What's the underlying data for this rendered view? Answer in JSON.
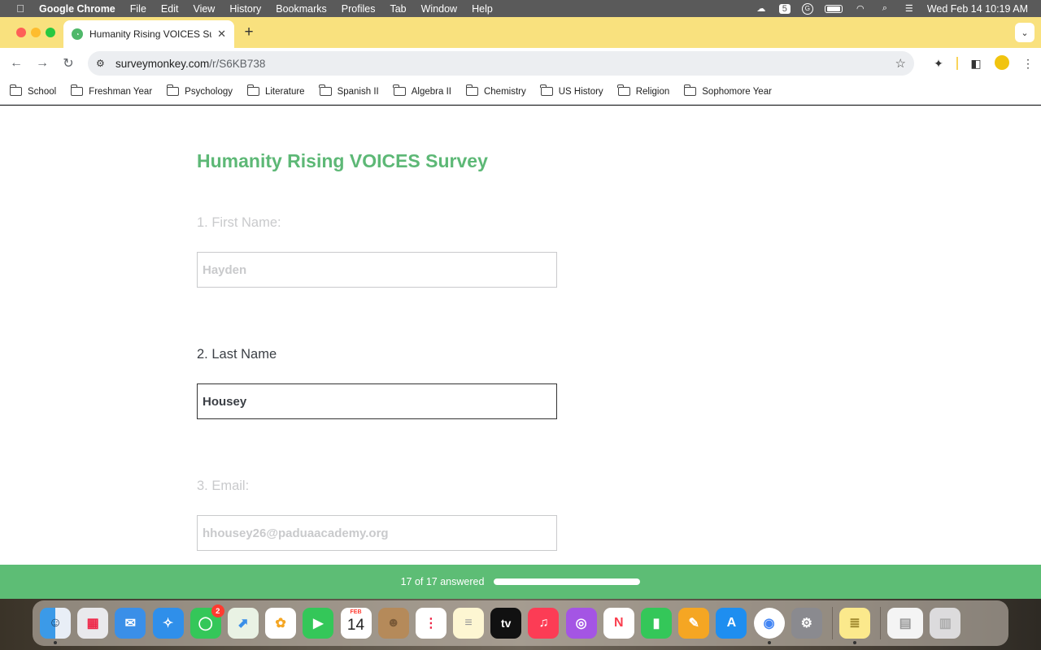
{
  "menubar": {
    "app_name": "Google Chrome",
    "items": [
      "File",
      "Edit",
      "View",
      "History",
      "Bookmarks",
      "Profiles",
      "Tab",
      "Window",
      "Help"
    ],
    "clock": "Wed Feb 14  10:19 AM"
  },
  "tab": {
    "title": "Humanity Rising VOICES Surv",
    "close": "✕"
  },
  "newtab": "+",
  "omnibox": {
    "url_host": "surveymonkey.com",
    "url_path": "/r/S6KB738"
  },
  "bookmarks": [
    "School",
    "Freshman Year",
    "Psychology",
    "Literature",
    "Spanish II",
    "Algebra II",
    "Chemistry",
    "US History",
    "Religion",
    "Sophomore Year"
  ],
  "survey": {
    "title": "Humanity Rising VOICES Survey",
    "questions": [
      {
        "label": "1. First Name:",
        "value": "Hayden"
      },
      {
        "label": "2. Last Name",
        "value": "Housey"
      },
      {
        "label": "3. Email:",
        "value": "hhousey26@paduaacademy.org"
      }
    ]
  },
  "progress": {
    "text": "17 of 17 answered",
    "fraction": 1.0,
    "color": "#5dbd75"
  },
  "dock": {
    "messages_badge": "2",
    "calendar_month": "FEB",
    "calendar_day": "14",
    "tv_label": "tv"
  },
  "colors": {
    "title_green": "#5db876",
    "tabstrip": "#f9e17e"
  }
}
